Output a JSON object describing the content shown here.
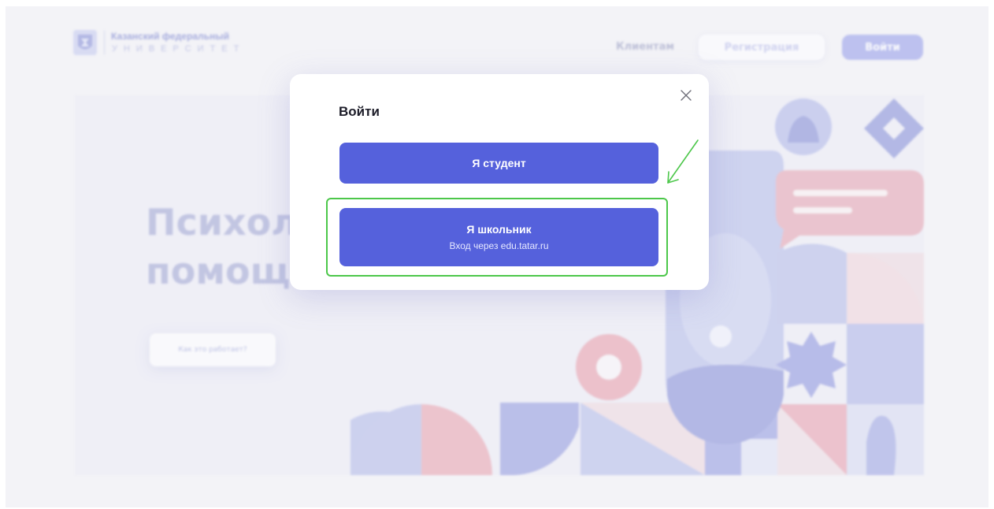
{
  "header": {
    "logo_line1": "Казанский федеральный",
    "logo_line2": "УНИВЕРСИТЕТ",
    "nav_clients": "Клиентам",
    "register_label": "Регистрация",
    "login_label": "Войти"
  },
  "hero": {
    "title": "Психологическая\nпомощь",
    "how_it_works_label": "Как это работает?"
  },
  "modal": {
    "title": "Войти",
    "student_button": "Я студент",
    "school_button": "Я школьник",
    "school_button_sub": "Вход через edu.tatar.ru"
  },
  "colors": {
    "primary": "#5561dc",
    "annotation_green": "#4cc74a",
    "pink": "#e9a9b8",
    "lavender": "#a9b0e8"
  },
  "icons": {
    "close": "close-icon",
    "logo": "kfu-emblem-icon",
    "annotation": "annotation-arrow"
  }
}
